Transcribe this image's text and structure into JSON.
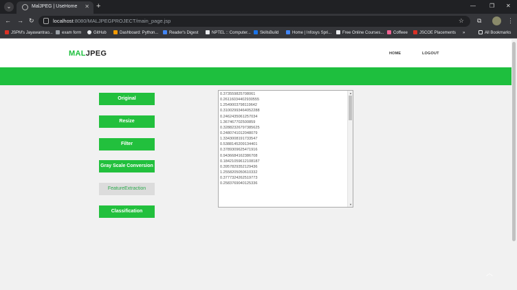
{
  "browser": {
    "tab_title": "MalJPEG | UseHome",
    "tab_close": "✕",
    "new_tab": "+",
    "url_host": "localhost",
    "url_rest": ":8080/MALJPEGPROJECT/main_page.jsp",
    "menu_icon": "⌄",
    "bookmarks": [
      {
        "label": "JSPM's Jayawantrao...",
        "color": "#d93025"
      },
      {
        "label": "exam form",
        "color": "#9aa0a6"
      },
      {
        "label": "GitHub",
        "color": "#e8eaed"
      },
      {
        "label": "Dashboard: Python...",
        "color": "#f29900"
      },
      {
        "label": "Reader's Digest",
        "color": "#4285f4"
      },
      {
        "label": "NPTEL :: Computer...",
        "color": "#e8eaed"
      },
      {
        "label": "SkillsBuild",
        "color": "#1a73e8"
      },
      {
        "label": "Home | Infosys Spri...",
        "color": "#4285f4"
      },
      {
        "label": "Free Online Courses...",
        "color": "#e8eaed"
      },
      {
        "label": "Coffeee",
        "color": "#f06292"
      },
      {
        "label": "JSCOE Placements",
        "color": "#d93025"
      }
    ],
    "bookmarks_more": "»",
    "all_bookmarks": "All Bookmarks"
  },
  "header": {
    "logo_part1": "MAL",
    "logo_part2": "JPEG",
    "nav": [
      "HOME",
      "LOGOUT"
    ]
  },
  "sidebar": {
    "buttons": [
      {
        "label": "Original",
        "enabled": true
      },
      {
        "label": "Resize",
        "enabled": true
      },
      {
        "label": "Filter",
        "enabled": true
      },
      {
        "label": "Gray Scale Conversion",
        "enabled": true
      },
      {
        "label": "FeatureExtraction",
        "enabled": false
      },
      {
        "label": "Classification",
        "enabled": true
      }
    ]
  },
  "output": {
    "lines": [
      "0.373559825708061",
      "0.26116034402930555",
      "1.2549003798119642",
      "0.31002993464052288",
      "0.2462435061257034",
      "1.367467702500859",
      "0.32882326797385625",
      "0.2480741012048079",
      "1.3343008191733547",
      "0.5388145209134401",
      "0.3789309625471916",
      "0.9436684162386708",
      "0.18421059612108187",
      "0.3957829352129436",
      "1.2558205050610332",
      "0.3777324262519773",
      "0.2583769040125336"
    ]
  }
}
